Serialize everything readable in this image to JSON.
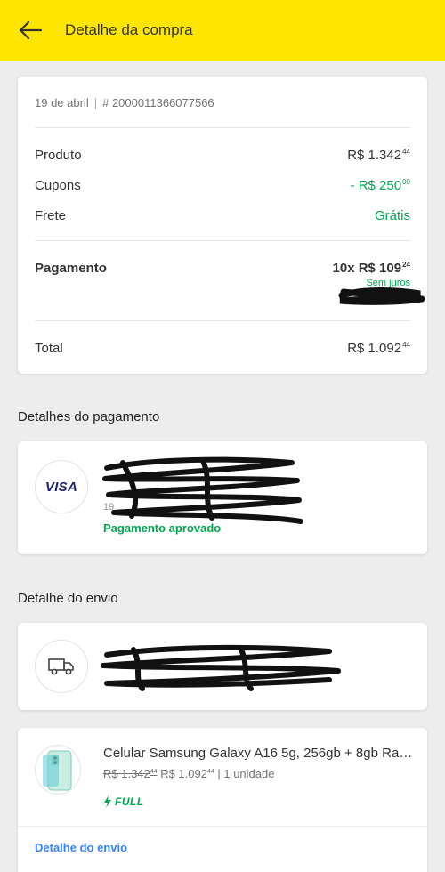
{
  "topbar": {
    "title": "Detalhe da compra",
    "back_icon": "arrow-left-icon",
    "color": "#ffe600"
  },
  "summary": {
    "date": "19 de abril",
    "separator": "|",
    "order_number": "# 2000011366077566",
    "produto_label": "Produto",
    "produto_value": "R$ 1.342",
    "produto_cents": "44",
    "cupons_label": "Cupons",
    "cupons_value": "- R$ 250",
    "cupons_cents": "00",
    "frete_label": "Frete",
    "frete_value": "Grátis",
    "pagamento_label": "Pagamento",
    "pagamento_value": "10x R$ 109",
    "pagamento_cents": "24",
    "pagamento_note": "Sem juros",
    "total_label": "Total",
    "total_value": "R$ 1.092",
    "total_cents": "44"
  },
  "payment_section": {
    "title": "Detalhes do pagamento",
    "card_brand": "VISA",
    "partial_text": "19",
    "status": "Pagamento aprovado"
  },
  "shipping_section": {
    "title": "Detalhe do envio",
    "icon": "truck-icon"
  },
  "product": {
    "title": "Celular Samsung Galaxy A16 5g, 256gb + 8gb Ram...",
    "old_price": "R$ 1.342",
    "old_cents": "44",
    "price": "R$ 1.092",
    "price_cents": "44",
    "quantity": "| 1 unidade",
    "badge": "FULL",
    "link": "Detalhe do envio"
  },
  "colors": {
    "green": "#00a650",
    "link": "#3483fa",
    "visa": "#1a1f71"
  }
}
